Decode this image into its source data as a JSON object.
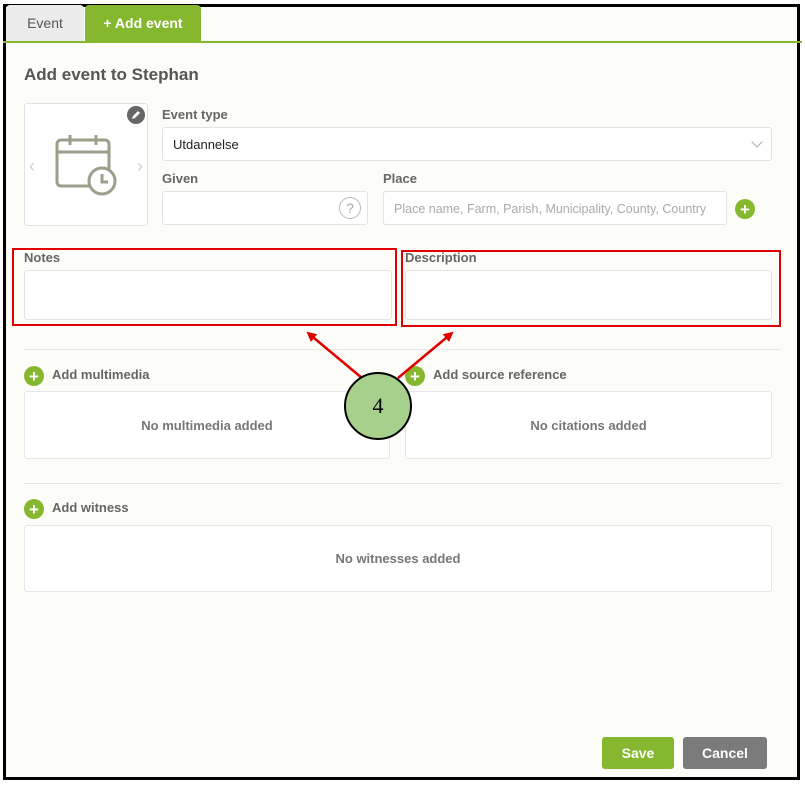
{
  "tabs": [
    {
      "label": "Event"
    },
    {
      "label": "+ Add event"
    }
  ],
  "title": "Add event to Stephan",
  "event_type": {
    "label": "Event type",
    "value": "Utdannelse"
  },
  "given": {
    "label": "Given",
    "help": "?"
  },
  "place": {
    "label": "Place",
    "placeholder": "Place name, Farm, Parish, Municipality, County, Country"
  },
  "notes": {
    "label": "Notes"
  },
  "description": {
    "label": "Description"
  },
  "multimedia": {
    "add_label": "Add multimedia",
    "empty": "No multimedia added"
  },
  "source": {
    "add_label": "Add source reference",
    "empty": "No citations added"
  },
  "witness": {
    "add_label": "Add witness",
    "empty": "No witnesses added"
  },
  "callout": {
    "number": "4"
  },
  "buttons": {
    "save": "Save",
    "cancel": "Cancel"
  },
  "colors": {
    "accent": "#86b82f",
    "annotation_red": "#e00000",
    "callout_fill": "#a8d08d",
    "cancel_gray": "#7b7b7b"
  },
  "icons": [
    "pencil-icon",
    "calendar-clock-icon",
    "chevron-left-icon",
    "chevron-right-icon",
    "chevron-down-icon",
    "help-icon",
    "plus-icon"
  ]
}
